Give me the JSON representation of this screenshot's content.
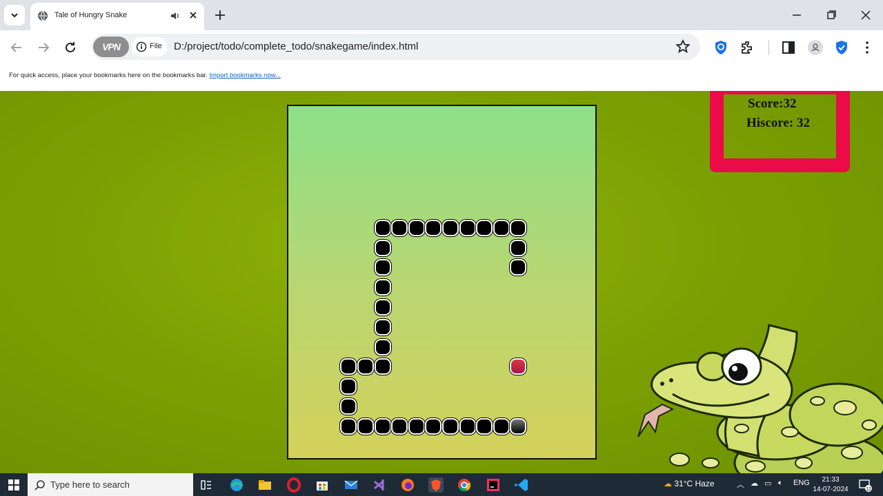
{
  "browser": {
    "tab_title": "Tale of Hungry Snake",
    "vpn_label": "VPN",
    "file_label": "File",
    "url": "D:/project/todo/complete_todo/snakegame/index.html",
    "bookmarks_text": "For quick access, place your bookmarks here on the bookmarks bar.",
    "bookmarks_link": "Import bookmarks now..."
  },
  "game": {
    "score_label": "Score:32",
    "hiscore_label": "Hiscore: 32",
    "snake_body": [
      [
        6,
        5
      ],
      [
        7,
        5
      ],
      [
        8,
        5
      ],
      [
        9,
        5
      ],
      [
        10,
        5
      ],
      [
        11,
        5
      ],
      [
        12,
        5
      ],
      [
        13,
        5
      ],
      [
        14,
        5
      ],
      [
        14,
        6
      ],
      [
        14,
        7
      ],
      [
        6,
        6
      ],
      [
        6,
        7
      ],
      [
        6,
        8
      ],
      [
        6,
        9
      ],
      [
        6,
        10
      ],
      [
        6,
        11
      ],
      [
        4,
        12
      ],
      [
        5,
        12
      ],
      [
        6,
        12
      ],
      [
        4,
        13
      ],
      [
        4,
        14
      ],
      [
        4,
        15
      ],
      [
        5,
        15
      ],
      [
        6,
        15
      ],
      [
        7,
        15
      ],
      [
        8,
        15
      ],
      [
        9,
        15
      ],
      [
        10,
        15
      ],
      [
        11,
        15
      ],
      [
        12,
        15
      ],
      [
        13,
        15
      ]
    ],
    "snake_head": [
      14,
      15
    ],
    "food": [
      14,
      12
    ],
    "colors": {
      "board_border": "#111111",
      "score_border": "#ea0b48",
      "page_bg": "#7da103"
    }
  },
  "taskbar": {
    "search_placeholder": "Type here to search",
    "weather": "31°C  Haze",
    "language": "ENG",
    "time": "21:33",
    "date": "14-07-2024",
    "notification_count": "12",
    "apps": [
      "task-view-icon",
      "edge-icon",
      "file-explorer-icon",
      "opera-icon",
      "store-icon",
      "mail-icon",
      "visual-studio-icon",
      "firefox-icon",
      "brave-icon",
      "chrome-icon",
      "intellij-icon",
      "vscode-icon"
    ]
  }
}
